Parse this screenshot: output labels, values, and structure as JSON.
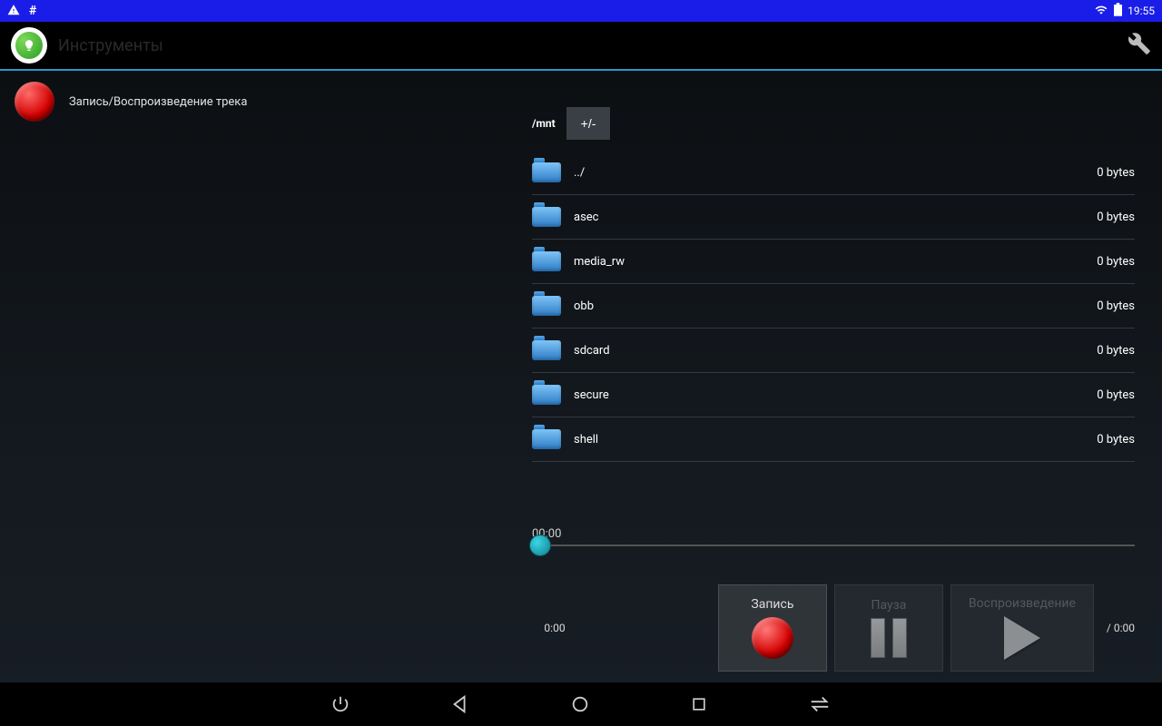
{
  "status_bar": {
    "time": "19:55"
  },
  "app_header": {
    "title": "Инструменты"
  },
  "track": {
    "label": "Запись/Воспроизведение трека"
  },
  "file_browser": {
    "path": "/mnt",
    "toggle_label": "+/-",
    "items": [
      {
        "name": "../",
        "size": "0 bytes"
      },
      {
        "name": "asec",
        "size": "0 bytes"
      },
      {
        "name": "media_rw",
        "size": "0 bytes"
      },
      {
        "name": "obb",
        "size": "0 bytes"
      },
      {
        "name": "sdcard",
        "size": "0 bytes"
      },
      {
        "name": "secure",
        "size": "0 bytes"
      },
      {
        "name": "shell",
        "size": "0 bytes"
      }
    ]
  },
  "timeline": {
    "position_label": "00:00"
  },
  "transport": {
    "elapsed": "0:00",
    "total": "/ 0:00",
    "record_label": "Запись",
    "pause_label": "Пауза",
    "play_label": "Воспроизведение"
  }
}
